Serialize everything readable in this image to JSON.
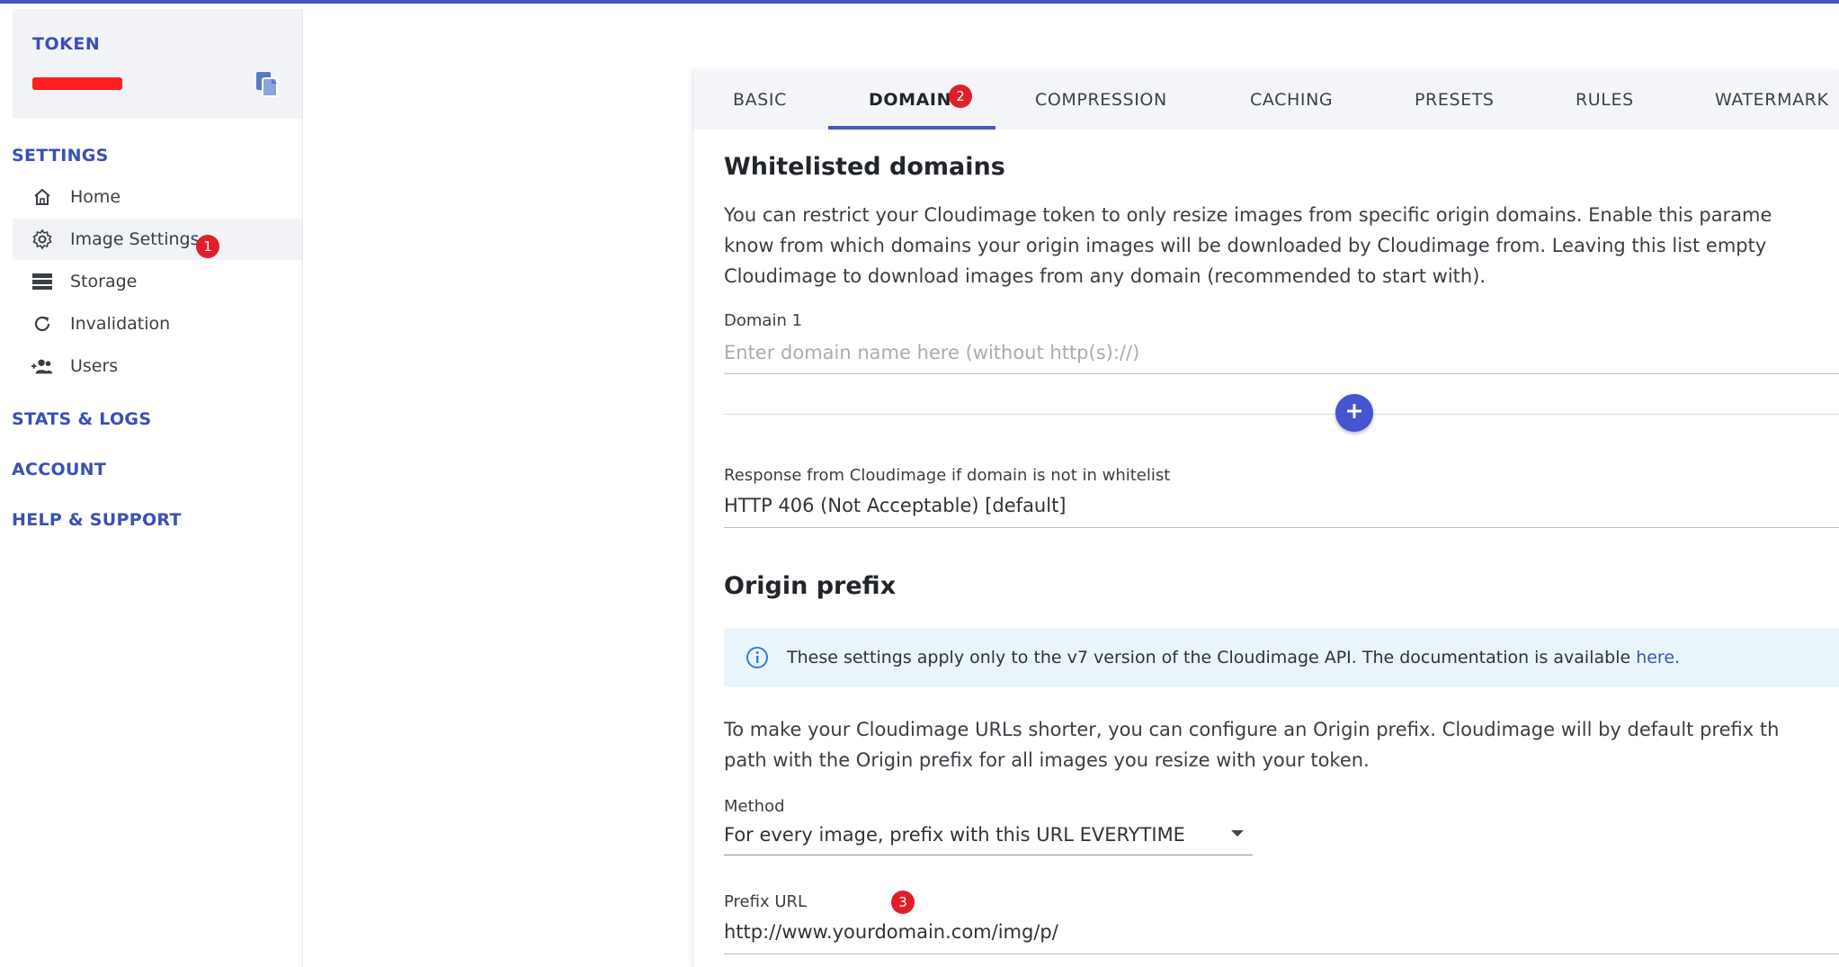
{
  "sidebar": {
    "token_title": "TOKEN",
    "settings_label": "SETTINGS",
    "items": [
      {
        "label": "Home",
        "icon": "home-icon"
      },
      {
        "label": "Image Settings",
        "icon": "gear-icon"
      },
      {
        "label": "Storage",
        "icon": "storage-icon"
      },
      {
        "label": "Invalidation",
        "icon": "refresh-icon"
      },
      {
        "label": "Users",
        "icon": "users-icon"
      }
    ],
    "stats_label": "STATS & LOGS",
    "account_label": "ACCOUNT",
    "help_label": "HELP & SUPPORT"
  },
  "badges": {
    "one": "1",
    "two": "2",
    "three": "3"
  },
  "tabs": [
    "BASIC",
    "DOMAINS",
    "COMPRESSION",
    "CACHING",
    "PRESETS",
    "RULES",
    "WATERMARK"
  ],
  "whitelist": {
    "title": "Whitelisted domains",
    "desc_line1": "You can restrict your Cloudimage token to only resize images from specific origin domains. Enable this parame",
    "desc_line2": "know from which domains your origin images will be downloaded by Cloudimage from. Leaving this list empty",
    "desc_line3": "Cloudimage to download images from any domain (recommended to start with).",
    "domain_label": "Domain  1",
    "domain_placeholder": "Enter domain name here (without http(s)://)",
    "response_label": "Response from Cloudimage if domain is not in whitelist",
    "response_value": "HTTP 406 (Not Acceptable) [default]"
  },
  "origin": {
    "title": "Origin prefix",
    "info_text": "These settings apply only to the v7 version of the Cloudimage API. The documentation is available ",
    "info_link": "here.",
    "desc_line1": "To make your Cloudimage URLs shorter, you can configure an Origin prefix. Cloudimage will by default prefix th",
    "desc_line2": "path with the Origin prefix for all images you resize with your token.",
    "method_label": "Method",
    "method_value": "For every image, prefix with this URL EVERYTIME",
    "prefix_label": "Prefix URL",
    "prefix_value": "http://www.yourdomain.com/img/p/"
  },
  "colors": {
    "accent": "#4a57c2",
    "badge": "#e11f2a",
    "info_bg": "#eaf4fb"
  }
}
